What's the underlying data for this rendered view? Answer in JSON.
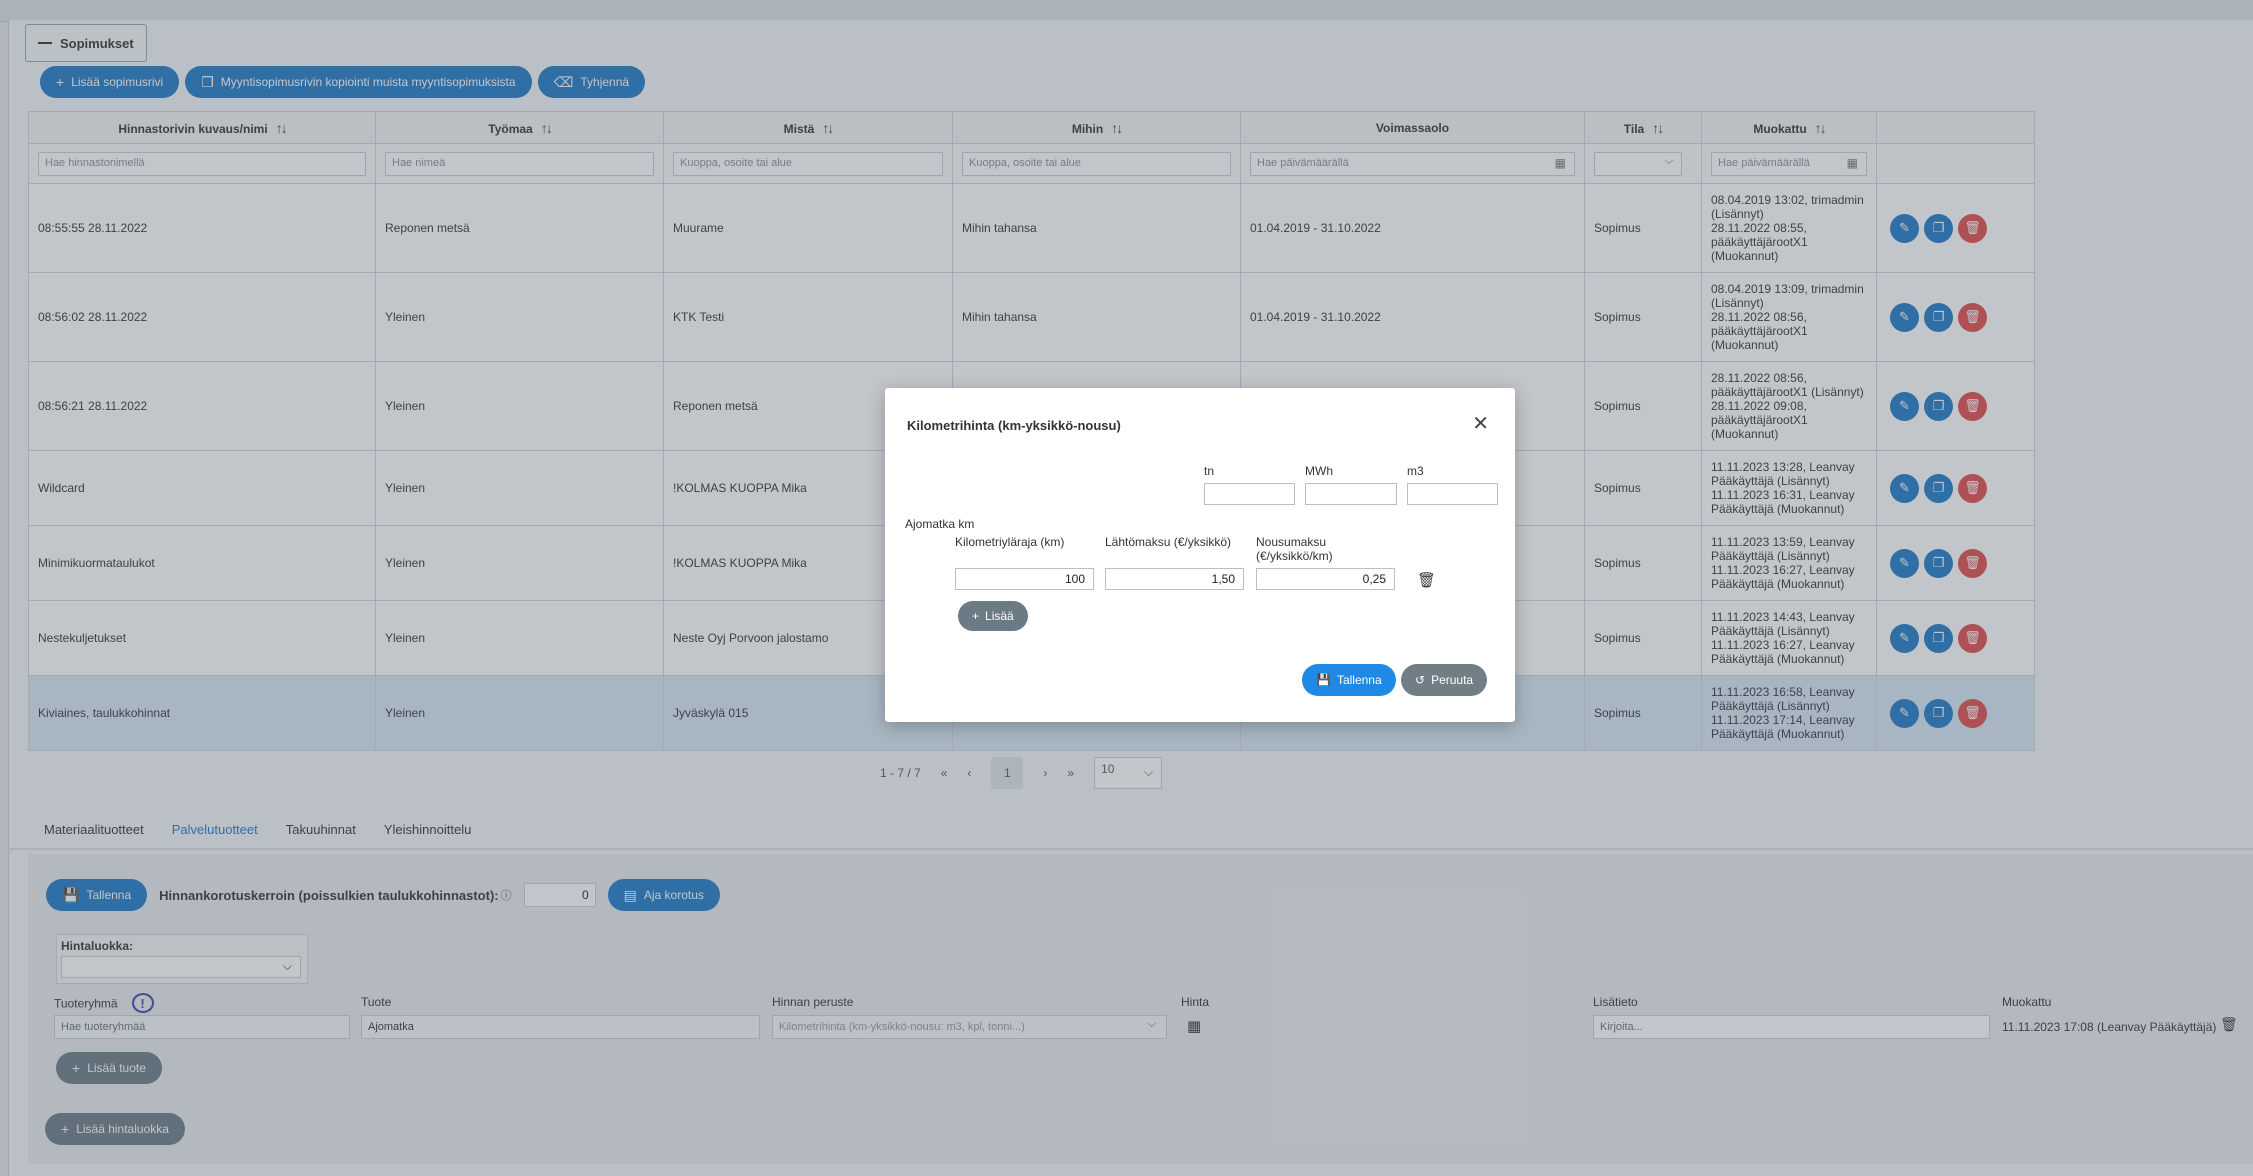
{
  "section": {
    "title": "Sopimukset"
  },
  "toolbar": {
    "add_row": "Lisää sopimusrivi",
    "copy": "Myyntisopimusrivin kopiointi muista myyntisopimuksista",
    "clear": "Tyhjennä"
  },
  "table": {
    "columns": [
      "Hinnastorivin kuvaus/nimi",
      "Työmaa",
      "Mistä",
      "Mihin",
      "Voimassaolo",
      "Tila",
      "Muokattu"
    ],
    "filters": [
      "Hae hinnastonimellä",
      "Hae nimeä",
      "Kuoppa, osoite tai alue",
      "Kuoppa, osoite tai alue",
      "Hae päivämäärällä",
      "",
      "Hae päivämäärällä"
    ],
    "rows": [
      {
        "name": "08:55:55 28.11.2022",
        "site": "Reponen metsä",
        "from": "Muurame",
        "to": "Mihin tahansa",
        "valid": "01.04.2019 - 31.10.2022",
        "status": "Sopimus",
        "modified": [
          "08.04.2019 13:02, trimadmin",
          "(Lisännyt)",
          "28.11.2022 08:55,",
          "pääkäyttäjärootX1",
          "(Muokannut)"
        ]
      },
      {
        "name": "08:56:02 28.11.2022",
        "site": "Yleinen",
        "from": "KTK Testi",
        "to": "Mihin tahansa",
        "valid": "01.04.2019 - 31.10.2022",
        "status": "Sopimus",
        "modified": [
          "08.04.2019 13:09, trimadmin",
          "(Lisännyt)",
          "28.11.2022 08:56,",
          "pääkäyttäjärootX1",
          "(Muokannut)"
        ]
      },
      {
        "name": "08:56:21 28.11.2022",
        "site": "Yleinen",
        "from": "Reponen metsä",
        "to": "",
        "valid": "",
        "status": "Sopimus",
        "modified": [
          "28.11.2022 08:56,",
          "pääkäyttäjärootX1 (Lisännyt)",
          "28.11.2022 09:08,",
          "pääkäyttäjärootX1",
          "(Muokannut)"
        ]
      },
      {
        "name": "Wildcard",
        "site": "Yleinen",
        "from": "!KOLMAS KUOPPA Mika",
        "to": "",
        "valid": "",
        "status": "Sopimus",
        "modified": [
          "11.11.2023 13:28, Leanvay",
          "Pääkäyttäjä (Lisännyt)",
          "11.11.2023 16:31, Leanvay",
          "Pääkäyttäjä (Muokannut)"
        ]
      },
      {
        "name": "Minimikuormataulukot",
        "site": "Yleinen",
        "from": "!KOLMAS KUOPPA Mika",
        "to": "",
        "valid": "",
        "status": "Sopimus",
        "modified": [
          "11.11.2023 13:59, Leanvay",
          "Pääkäyttäjä (Lisännyt)",
          "11.11.2023 16:27, Leanvay",
          "Pääkäyttäjä (Muokannut)"
        ]
      },
      {
        "name": "Nestekuljetukset",
        "site": "Yleinen",
        "from": "Neste Oyj Porvoon jalostamo",
        "to": "",
        "valid": "",
        "status": "Sopimus",
        "modified": [
          "11.11.2023 14:43, Leanvay",
          "Pääkäyttäjä (Lisännyt)",
          "11.11.2023 16:27, Leanvay",
          "Pääkäyttäjä (Muokannut)"
        ]
      },
      {
        "name": "Kiviaines, taulukkohinnat",
        "site": "Yleinen",
        "from": "Jyväskylä 015",
        "to": "",
        "valid": "",
        "status": "Sopimus",
        "modified": [
          "11.11.2023 16:58, Leanvay",
          "Pääkäyttäjä (Lisännyt)",
          "11.11.2023 17:14, Leanvay",
          "Pääkäyttäjä (Muokannut)"
        ]
      }
    ]
  },
  "pager": {
    "range": "1 - 7 / 7",
    "page": "1",
    "per_page": "10"
  },
  "tabs": [
    "Materiaalituotteet",
    "Palvelutuotteet",
    "Takuuhinnat",
    "Yleishinnoittelu"
  ],
  "services": {
    "save": "Tallenna",
    "factor_label": "Hinnankorotuskerroin (poissulkien taulukkohinnastot):",
    "factor_value": "0",
    "run_raise": "Aja korotus",
    "price_class_label": "Hintaluokka:",
    "col_group": "Tuoteryhmä",
    "col_product": "Tuote",
    "col_basis": "Hinnan peruste",
    "col_price": "Hinta",
    "col_info": "Lisätieto",
    "col_modified": "Muokattu",
    "group_placeholder": "Hae tuoteryhmää",
    "product_value": "Ajomatka",
    "basis_value": "Kilometrihinta (km-yksikkö-nousu: m3, kpl, tonni...)",
    "info_placeholder": "Kirjoita...",
    "modified_value": "11.11.2023 17:08 (Leanvay Pääkäyttäjä)",
    "add_product": "Lisää tuote",
    "add_price_class": "Lisää hintaluokka"
  },
  "modal": {
    "title": "Kilometrihinta (km-yksikkö-nousu)",
    "unit_tn": "tn",
    "unit_mwh": "MWh",
    "unit_m3": "m3",
    "group_label": "Ajomatka km",
    "col_km": "Kilometriyläraja (km)",
    "col_start": "Lähtömaksu (€/yksikkö)",
    "col_rise_1": "Nousumaksu",
    "col_rise_2": "(€/yksikkö/km)",
    "km_value": "100",
    "start_value": "1,50",
    "rise_value": "0,25",
    "add": "Lisää",
    "save": "Tallenna",
    "cancel": "Peruuta"
  },
  "colors": {
    "primary": "#1f78c8",
    "danger": "#e04b4b",
    "secondary": "#6b7b86"
  }
}
